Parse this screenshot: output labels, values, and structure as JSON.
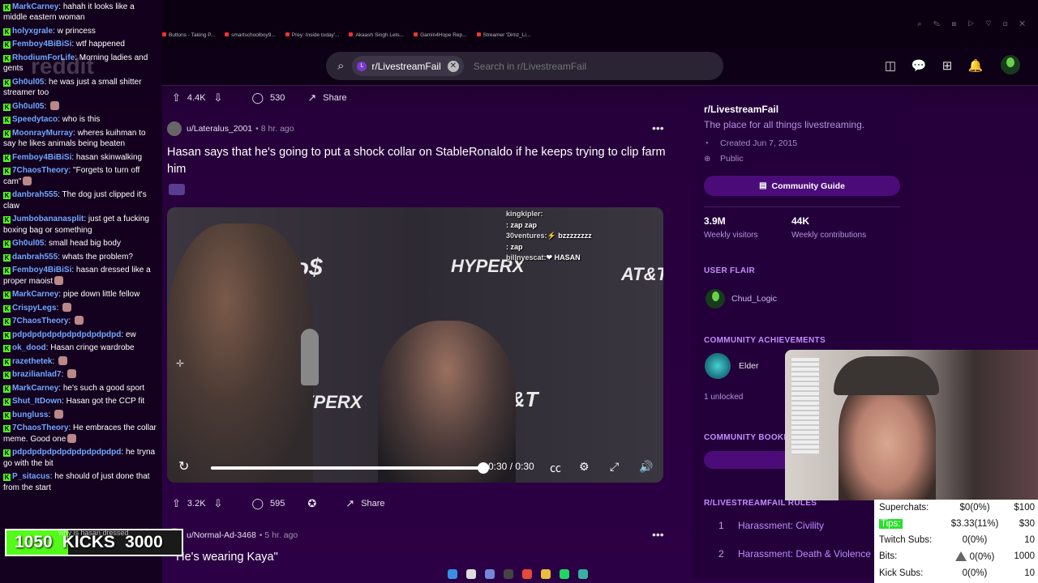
{
  "chat": {
    "messages": [
      {
        "user": "MarkCarney",
        "user_color": "#6fa8ff",
        "text": "hahah it looks like a middle eastern woman",
        "emote": false
      },
      {
        "user": "holyxgrale",
        "user_color": "#6fa8ff",
        "text": "w princess",
        "emote": false
      },
      {
        "user": "Femboy4BiBiSi",
        "user_color": "#6fa8ff",
        "text": "wtf happened",
        "emote": false
      },
      {
        "user": "RhodiumForLife",
        "user_color": "#6fa8ff",
        "text": "Morning ladies and gents",
        "emote": false
      },
      {
        "user": "Gh0ul05",
        "user_color": "#6fa8ff",
        "text": "he was just a small shitter streamer too",
        "emote": false
      },
      {
        "user": "Gh0ul05",
        "user_color": "#6fa8ff",
        "text": "",
        "emote": true
      },
      {
        "user": "Speedytaco",
        "user_color": "#6fa8ff",
        "text": "who is this",
        "emote": false
      },
      {
        "user": "MoonrayMurray",
        "user_color": "#6fa8ff",
        "text": "wheres kuihman to say he likes animals being beaten",
        "emote": false
      },
      {
        "user": "Femboy4BiBiSi",
        "user_color": "#6fa8ff",
        "text": "hasan skinwalking",
        "emote": false
      },
      {
        "user": "7ChaosTheory",
        "user_color": "#6fa8ff",
        "text": "\"Forgets to turn off cam\"",
        "emote": true
      },
      {
        "user": "danbrah555",
        "user_color": "#6fa8ff",
        "text": "The dog just clipped it's claw",
        "emote": false
      },
      {
        "user": "Jumbobananasplit",
        "user_color": "#6fa8ff",
        "text": "just get a fucking boxing bag or something",
        "emote": false
      },
      {
        "user": "Gh0ul05",
        "user_color": "#6fa8ff",
        "text": "small head big body",
        "emote": false
      },
      {
        "user": "danbrah555",
        "user_color": "#6fa8ff",
        "text": "whats the problem?",
        "emote": false
      },
      {
        "user": "Femboy4BiBiSi",
        "user_color": "#6fa8ff",
        "text": "hasan dressed like a proper maoist",
        "emote": true
      },
      {
        "user": "MarkCarney",
        "user_color": "#6fa8ff",
        "text": "pipe down little fellow",
        "emote": false
      },
      {
        "user": "CrispyLegs",
        "user_color": "#6fa8ff",
        "text": "",
        "emote": true
      },
      {
        "user": "7ChaosTheory",
        "user_color": "#6fa8ff",
        "text": "",
        "emote": true
      },
      {
        "user": "pdpdpdpdpdpdpdpdpdpdpd",
        "user_color": "#6fa8ff",
        "text": "ew",
        "emote": false
      },
      {
        "user": "ok_dood",
        "user_color": "#6fa8ff",
        "text": "Hasan cringe wardrobe",
        "emote": false
      },
      {
        "user": "razethetek",
        "user_color": "#6fa8ff",
        "text": "",
        "emote": true
      },
      {
        "user": "brazilianlad7",
        "user_color": "#6fa8ff",
        "text": "",
        "emote": true
      },
      {
        "user": "MarkCarney",
        "user_color": "#6fa8ff",
        "text": "he's such a good sport",
        "emote": false
      },
      {
        "user": "Shut_ItDown",
        "user_color": "#6fa8ff",
        "text": "Hasan got the CCP fit",
        "emote": false
      },
      {
        "user": "bungluss",
        "user_color": "#6fa8ff",
        "text": "",
        "emote": true
      },
      {
        "user": "7ChaosTheory",
        "user_color": "#6fa8ff",
        "text": "He embraces the collar meme. Good one",
        "emote": true
      },
      {
        "user": "pdpdpdpdpdpdpdpdpdpdpd",
        "user_color": "#6fa8ff",
        "text": "he tryna go with the bit",
        "emote": false
      },
      {
        "user": "P_sitacus",
        "user_color": "#6fa8ff",
        "text": "he should of just done that from the start",
        "emote": false
      }
    ]
  },
  "kicks_goal": {
    "current": "1050",
    "label": "KICKS",
    "goal": "3000",
    "progress": 0.35,
    "overlay_text": "why is hasan dressed"
  },
  "watermark": "reddit",
  "bookmarks": [
    "Buttons - Taking P...",
    "smartschoolboy9...",
    "Prey: Inside today'...",
    "Akaash Singh Lets...",
    "Gamin4Hope Rep...",
    "Streamer 'Dimz_Li..."
  ],
  "browser_icons": "⌕ ✎ ⊞ ▷ ♡ ⊡ ✕",
  "header": {
    "search_chip": "r/LivestreamFail",
    "search_placeholder": "Search in r/LivestreamFail",
    "icons": [
      "advertise-icon",
      "chat-icon",
      "create-icon",
      "notifications-icon"
    ]
  },
  "post": {
    "upvotes": "4.4K",
    "comments": "530",
    "share": "Share",
    "author": "u/Lateralus_2001",
    "time": "• 8 hr. ago",
    "title": "Hasan says that he's going to put a shock collar on StableRonaldo if he keeps trying to clip farm him",
    "video": {
      "overlay_chat": [
        {
          "user": "kingkipler:",
          "text": ""
        },
        {
          "user": "",
          "text": ": zap zap"
        },
        {
          "user": "30ventures:",
          "text": "⚡ bzzzzzzzz"
        },
        {
          "user": "",
          "text": ": zap"
        },
        {
          "user": "billnyescat:",
          "text": "❤ HASAN"
        }
      ],
      "banners": [
        "bno$",
        "HYPERX",
        "AT&T",
        "AT&T",
        "HYPERX"
      ],
      "time": "0:30 / 0:30",
      "progress": 1.0
    }
  },
  "post2": {
    "upvotes": "3.2K",
    "comments": "595",
    "share": "Share",
    "author": "u/Normal-Ad-3468",
    "time": "• 5 hr. ago",
    "title": "\"He's wearing Kaya\""
  },
  "sidebar": {
    "name": "r/LivestreamFail",
    "description": "The place for all things livestreaming.",
    "created": "Created Jun 7, 2015",
    "visibility": "Public",
    "community_guide": "Community Guide",
    "weekly_visitors_num": "3.9M",
    "weekly_visitors_label": "Weekly visitors",
    "weekly_contrib_num": "44K",
    "weekly_contrib_label": "Weekly contributions",
    "user_flair_heading": "USER FLAIR",
    "user_flair": "Chud_Logic",
    "achievements_heading": "COMMUNITY ACHIEVEMENTS",
    "achievement": "Elder",
    "unlocked": "1 unlocked",
    "bookmarks_heading": "COMMUNITY BOOKM",
    "rules_heading": "R/LIVESTREAMFAIL RULES",
    "rules": [
      {
        "num": "1",
        "text": "Harassment: Civility"
      },
      {
        "num": "2",
        "text": "Harassment: Death & Violence"
      }
    ]
  },
  "stats": {
    "rows": [
      {
        "label": "Superchats:",
        "value": "$0(0%)",
        "goal": "$100"
      },
      {
        "label": "Tips:",
        "value": "$3.33(11%)",
        "goal": "$30"
      },
      {
        "label": "Twitch Subs:",
        "value": "0(0%)",
        "goal": "10"
      },
      {
        "label": "Bits:",
        "value": "0(0%)",
        "goal": "1000"
      },
      {
        "label": "Kick Subs:",
        "value": "0(0%)",
        "goal": "10"
      }
    ]
  },
  "taskbar": [
    {
      "name": "start-icon",
      "color": "#3a8ee6"
    },
    {
      "name": "search-icon",
      "color": "#dddddd"
    },
    {
      "name": "discord-icon",
      "color": "#7289da"
    },
    {
      "name": "obs-icon",
      "color": "#444444"
    },
    {
      "name": "chrome-icon",
      "color": "#e84a3a"
    },
    {
      "name": "folder-icon",
      "color": "#e8c040"
    },
    {
      "name": "spotify-icon",
      "color": "#1ed760"
    },
    {
      "name": "app-icon",
      "color": "#3ab0a0"
    }
  ]
}
